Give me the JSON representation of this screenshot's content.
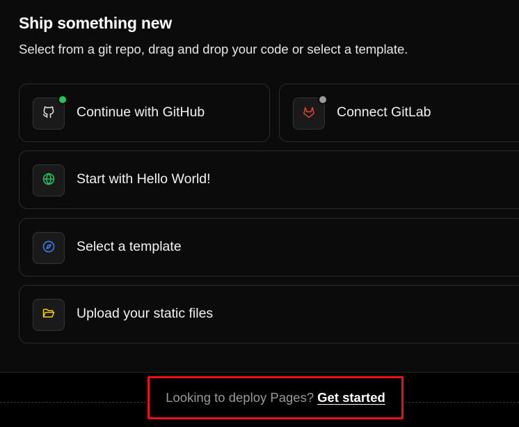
{
  "header": {
    "title": "Ship something new",
    "subtitle": "Select from a git repo, drag and drop your code or select a template."
  },
  "options": {
    "github": {
      "label": "Continue with GitHub",
      "icon": "github-icon",
      "status_color": "#22c55e"
    },
    "gitlab": {
      "label": "Connect GitLab",
      "icon": "gitlab-icon",
      "status_color": "#9a9a9a"
    },
    "hello_world": {
      "label": "Start with Hello World!",
      "icon": "globe-icon"
    },
    "template": {
      "label": "Select a template",
      "icon": "compass-icon"
    },
    "upload": {
      "label": "Upload your static files",
      "icon": "folder-open-icon"
    }
  },
  "footer": {
    "prompt": "Looking to deploy Pages?",
    "link_label": "Get started"
  },
  "colors": {
    "background": "#0b0b0b",
    "card_border": "#2c2c2c",
    "highlight_box": "#e8101a",
    "github_dot": "#22c55e",
    "gitlab_icon": "#e24329",
    "globe_icon": "#22c55e",
    "compass_icon": "#3b82f6",
    "folder_icon": "#facc15"
  }
}
